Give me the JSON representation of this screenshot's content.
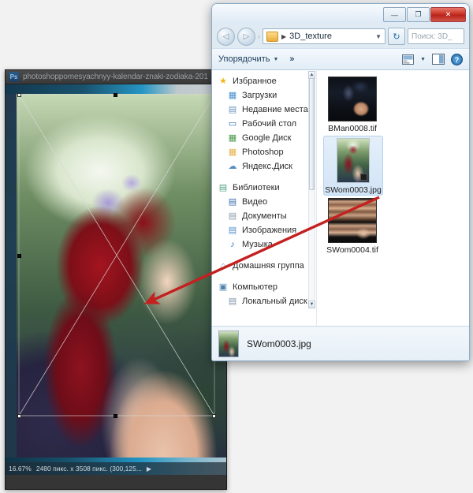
{
  "photoshop": {
    "icon": "photoshop-ps-icon",
    "icon_text": "Ps",
    "title": "photoshoppomesyachnyy-kalendar-znaki-zodiaka-201",
    "status": {
      "zoom": "16.67%",
      "dimensions": "2480 пикс. x 3508 пикс. (300,125...",
      "expand_arrow": "▶"
    }
  },
  "explorer": {
    "window_buttons": {
      "minimize": "—",
      "maximize": "❐",
      "close": "✕"
    },
    "nav": {
      "back": "◁",
      "forward": "▷",
      "separator": "›"
    },
    "address": {
      "folder_icon": "folder-icon",
      "crumb_arrow": "▶",
      "path": "3D_texture",
      "dropdown": "▼",
      "refresh": "↻"
    },
    "search": {
      "placeholder": "Поиск: 3D_"
    },
    "toolbar": {
      "organize": "Упорядочить",
      "organize_caret": "▼",
      "more": "»",
      "view_caret": "▼",
      "view_icon": "view-layout-icon",
      "preview_icon": "preview-pane-icon",
      "help_icon": "help-icon",
      "help_glyph": "?"
    },
    "sidebar": {
      "groups": [
        {
          "header": {
            "label": "Избранное",
            "icon": "star-icon",
            "glyph": "★"
          },
          "items": [
            {
              "label": "Загрузки",
              "icon": "downloads-folder-icon",
              "glyph": "▦"
            },
            {
              "label": "Недавние места",
              "icon": "recent-places-icon",
              "glyph": "▤"
            },
            {
              "label": "Рабочий стол",
              "icon": "desktop-icon",
              "glyph": "▭"
            },
            {
              "label": "Google Диск",
              "icon": "google-drive-folder-icon",
              "glyph": "▦"
            },
            {
              "label": "Photoshop",
              "icon": "folder-icon",
              "glyph": "▦"
            },
            {
              "label": "Яндекс.Диск",
              "icon": "yandex-disk-icon",
              "glyph": "☁"
            }
          ]
        },
        {
          "header": {
            "label": "Библиотеки",
            "icon": "libraries-icon",
            "glyph": "▤"
          },
          "items": [
            {
              "label": "Видео",
              "icon": "video-library-icon",
              "glyph": "▤"
            },
            {
              "label": "Документы",
              "icon": "documents-library-icon",
              "glyph": "▤"
            },
            {
              "label": "Изображения",
              "icon": "pictures-library-icon",
              "glyph": "▤"
            },
            {
              "label": "Музыка",
              "icon": "music-library-icon",
              "glyph": "♪"
            }
          ]
        },
        {
          "header": {
            "label": "Домашняя группа",
            "icon": "homegroup-icon",
            "glyph": "⌂"
          },
          "items": []
        },
        {
          "header": {
            "label": "Компьютер",
            "icon": "computer-icon",
            "glyph": "▣"
          },
          "items": [
            {
              "label": "Локальный диск",
              "icon": "local-disk-icon",
              "glyph": "▤"
            }
          ]
        }
      ],
      "scroll_up": "▲",
      "scroll_down": "▼"
    },
    "files": [
      {
        "name": "BMan0008.tif",
        "type": "tif",
        "selected": false,
        "thumb": "man-portrait-thumbnail"
      },
      {
        "name": "SWom0003.jpg",
        "type": "jpg",
        "selected": true,
        "thumb": "red-hair-woman-thumbnail"
      },
      {
        "name": "SWom0004.tif",
        "type": "tif",
        "selected": false,
        "thumb": "skin-texture-strips-thumbnail"
      }
    ],
    "detail_pane": {
      "file_name": "SWom0003.jpg",
      "thumb": "red-hair-woman-thumbnail"
    }
  },
  "annotation": {
    "arrow_color": "#c42020",
    "arrow_name": "drag-drop-arrow",
    "from": "SWom0003.jpg thumbnail",
    "to": "photoshop canvas"
  }
}
